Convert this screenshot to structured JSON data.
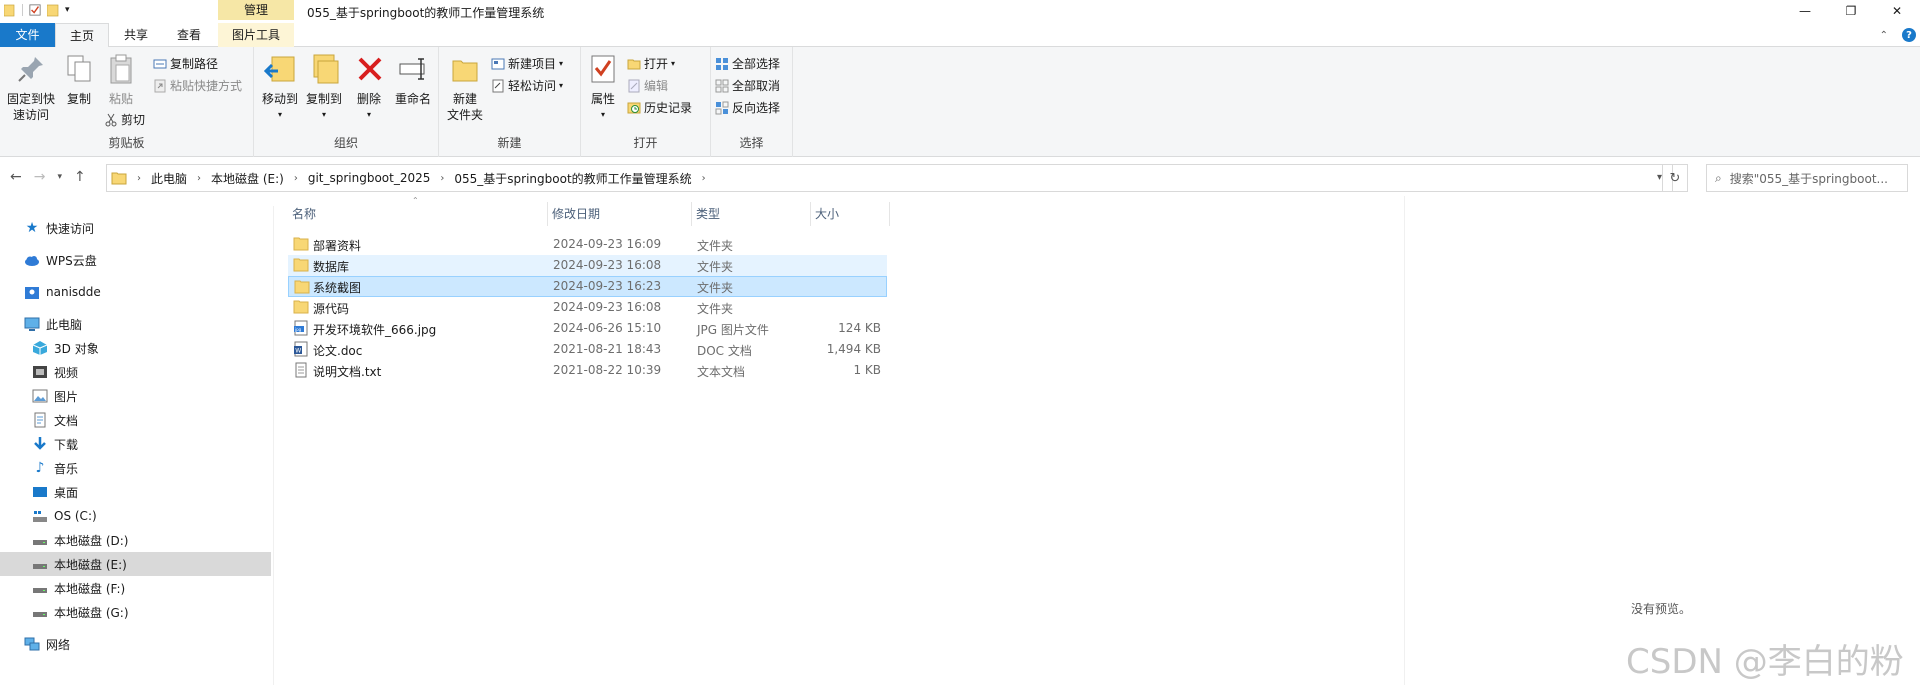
{
  "window": {
    "title": "055_基于springboot的教师工作量管理系统",
    "tool_tab": "管理",
    "controls": {
      "minimize": "—",
      "maximize": "❐",
      "close": "✕"
    }
  },
  "tabs": {
    "file": "文件",
    "home": "主页",
    "share": "共享",
    "view": "查看",
    "picture_tools": "图片工具"
  },
  "ribbon": {
    "clipboard": {
      "label": "剪贴板",
      "pin": "固定到快速访问",
      "pin_l1": "固定到快",
      "pin_l2": "速访问",
      "copy": "复制",
      "paste": "粘贴",
      "copy_path": "复制路径",
      "paste_shortcut": "粘贴快捷方式",
      "cut": "剪切"
    },
    "organize": {
      "label": "组织",
      "move_to": "移动到",
      "copy_to": "复制到",
      "delete": "删除",
      "rename": "重命名"
    },
    "new": {
      "label": "新建",
      "new_folder_l1": "新建",
      "new_folder_l2": "文件夹",
      "new_item": "新建项目",
      "easy_access": "轻松访问"
    },
    "open": {
      "label": "打开",
      "properties": "属性",
      "open": "打开",
      "edit": "编辑",
      "history": "历史记录"
    },
    "select": {
      "label": "选择",
      "select_all": "全部选择",
      "select_none": "全部取消",
      "invert": "反向选择"
    }
  },
  "address": {
    "crumbs": [
      "此电脑",
      "本地磁盘 (E:)",
      "git_springboot_2025",
      "055_基于springboot的教师工作量管理系统"
    ],
    "search_placeholder": "搜索\"055_基于springboot..."
  },
  "nav": {
    "quick_access": "快速访问",
    "wps": "WPS云盘",
    "user": "nanisdde",
    "this_pc": "此电脑",
    "objects3d": "3D 对象",
    "videos": "视频",
    "pictures": "图片",
    "documents": "文档",
    "downloads": "下载",
    "music": "音乐",
    "desktop": "桌面",
    "drive_c": "OS (C:)",
    "drive_d": "本地磁盘 (D:)",
    "drive_e": "本地磁盘 (E:)",
    "drive_f": "本地磁盘 (F:)",
    "drive_g": "本地磁盘 (G:)",
    "network": "网络"
  },
  "columns": {
    "name": "名称",
    "date": "修改日期",
    "type": "类型",
    "size": "大小"
  },
  "files": [
    {
      "name": "部署资料",
      "date": "2024-09-23 16:09",
      "type": "文件夹",
      "size": ""
    },
    {
      "name": "数据库",
      "date": "2024-09-23 16:08",
      "type": "文件夹",
      "size": ""
    },
    {
      "name": "系统截图",
      "date": "2024-09-23 16:23",
      "type": "文件夹",
      "size": ""
    },
    {
      "name": "源代码",
      "date": "2024-09-23 16:08",
      "type": "文件夹",
      "size": ""
    },
    {
      "name": "开发环境软件_666.jpg",
      "date": "2024-06-26 15:10",
      "type": "JPG 图片文件",
      "size": "124 KB"
    },
    {
      "name": "论文.doc",
      "date": "2021-08-21 18:43",
      "type": "DOC 文档",
      "size": "1,494 KB"
    },
    {
      "name": "说明文档.txt",
      "date": "2021-08-22 10:39",
      "type": "文本文档",
      "size": "1 KB"
    }
  ],
  "preview_text": "没有预览。",
  "watermark": "CSDN @李白的粉",
  "colors": {
    "file_tab": "#1979ca",
    "folder": "#f8d775",
    "selection": "#cce8ff",
    "hover": "#e5f3ff",
    "tool_tab": "#f6e7a6"
  }
}
